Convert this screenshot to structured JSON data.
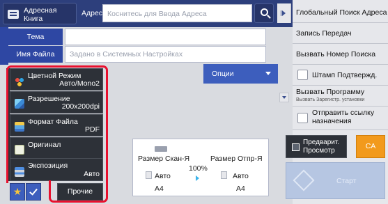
{
  "header": {
    "address_book_label": "Адресная Книга",
    "address_label": "Адрес",
    "address_placeholder": "Коснитесь для Ввода Адреса"
  },
  "fields": {
    "subject_label": "Тема",
    "subject_value": "",
    "filename_label": "Имя Файла",
    "filename_placeholder": "Задано в Системных Настройках",
    "options_label": "Опции"
  },
  "settings": [
    {
      "name": "Цветной Режим",
      "value": "Авто/Mono2",
      "icon": "color-mode-icon"
    },
    {
      "name": "Разрешение",
      "value": "200x200dpi",
      "icon": "resolution-icon"
    },
    {
      "name": "Формат Файла",
      "value": "PDF",
      "icon": "file-format-icon"
    },
    {
      "name": "Оригинал",
      "value": "",
      "icon": "original-icon"
    },
    {
      "name": "Экспозиция",
      "value": "Авто",
      "icon": "exposure-icon"
    }
  ],
  "bottom_left": {
    "other_label": "Прочие"
  },
  "scan_send": {
    "scan_size_label": "Размер Скан-Я",
    "send_size_label": "Размер Отпр-Я",
    "ratio": "100%",
    "scan_mode": "Авто",
    "scan_paper": "A4",
    "send_mode": "Авто",
    "send_paper": "A4"
  },
  "right_panel": {
    "global_search": "Глобальный Поиск Адреса",
    "send_log": "Запись Передач",
    "call_number": "Вызвать Номер Поиска",
    "stamp_confirm": "Штамп Подтвержд.",
    "call_program": "Вызвать Программу",
    "call_program_sub": "Вызвать Зарегистр. установки",
    "send_link": "Отправить ссылку назначения"
  },
  "actions": {
    "preview_label": "Предварит. Просмотр",
    "ca_label": "CA",
    "start_label": "Старт"
  },
  "colors": {
    "header_bg": "#2d3f7c",
    "field_label_bg": "#2e47a3",
    "accent_orange": "#f29a1c",
    "highlight_red": "#e8102e"
  }
}
